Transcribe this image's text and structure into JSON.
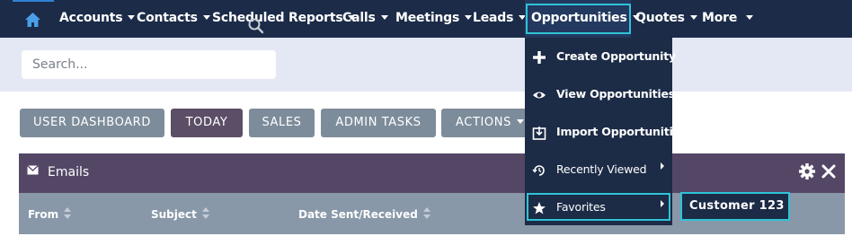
{
  "nav": {
    "home_icon": "home-icon",
    "items": [
      {
        "label": "Accounts"
      },
      {
        "label": "Contacts"
      },
      {
        "label": "Scheduled Reports"
      },
      {
        "label": "Calls"
      },
      {
        "label": "Meetings"
      },
      {
        "label": "Leads"
      },
      {
        "label": "Opportunities"
      },
      {
        "label": "Quotes"
      },
      {
        "label": "More"
      }
    ]
  },
  "search": {
    "placeholder": "Search...",
    "value": ""
  },
  "tabs": [
    {
      "label": "USER DASHBOARD"
    },
    {
      "label": "TODAY"
    },
    {
      "label": "SALES"
    },
    {
      "label": "ADMIN TASKS"
    },
    {
      "label": "ACTIONS"
    }
  ],
  "dashlet": {
    "title": "Emails",
    "columns": [
      "From",
      "Subject",
      "Date Sent/Received"
    ]
  },
  "dropdown": {
    "items": [
      {
        "label": "Create Opportunity",
        "icon": "plus-icon"
      },
      {
        "label": "View Opportunities",
        "icon": "eye-icon"
      },
      {
        "label": "Import Opportunities",
        "icon": "import-icon"
      },
      {
        "label": "Recently Viewed",
        "icon": "history-icon"
      },
      {
        "label": "Favorites",
        "icon": "star-icon"
      }
    ]
  },
  "favorites_submenu": {
    "item": "Customer 123"
  },
  "colors": {
    "navbar": "#1b2b48",
    "accent_focus": "#2fc3d8",
    "dashlet_header": "#544766",
    "column_band": "#8898a8",
    "tab_active": "#5b4e66",
    "tab": "#7d8c9a"
  }
}
